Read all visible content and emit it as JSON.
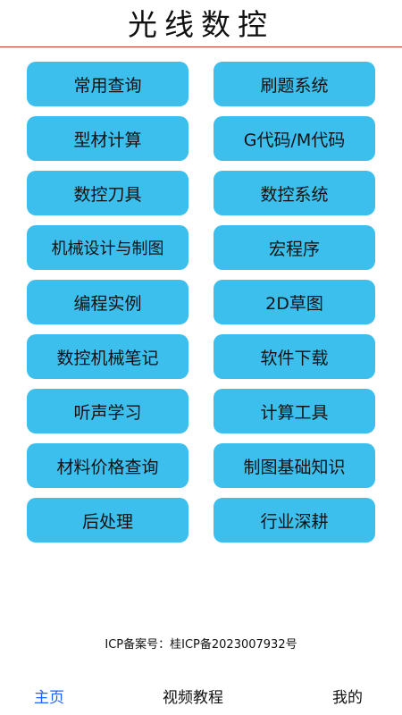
{
  "header": {
    "title": "光线数控",
    "divider_color": "#c8382f"
  },
  "menu": {
    "button_color": "#3dbfee",
    "items": [
      {
        "label": "常用查询"
      },
      {
        "label": "刷题系统"
      },
      {
        "label": "型材计算"
      },
      {
        "label": "G代码/M代码"
      },
      {
        "label": "数控刀具"
      },
      {
        "label": "数控系统"
      },
      {
        "label": "机械设计与制图"
      },
      {
        "label": "宏程序"
      },
      {
        "label": "编程实例"
      },
      {
        "label": "2D草图"
      },
      {
        "label": "数控机械笔记"
      },
      {
        "label": "软件下载"
      },
      {
        "label": "听声学习"
      },
      {
        "label": "计算工具"
      },
      {
        "label": "材料价格查询"
      },
      {
        "label": "制图基础知识"
      },
      {
        "label": "后处理"
      },
      {
        "label": "行业深耕"
      }
    ]
  },
  "footer": {
    "icp": "ICP备案号：桂ICP备2023007932号"
  },
  "tabbar": {
    "active_color": "#1f63ff",
    "home": "主页",
    "video": "视频教程",
    "mine": "我的"
  }
}
